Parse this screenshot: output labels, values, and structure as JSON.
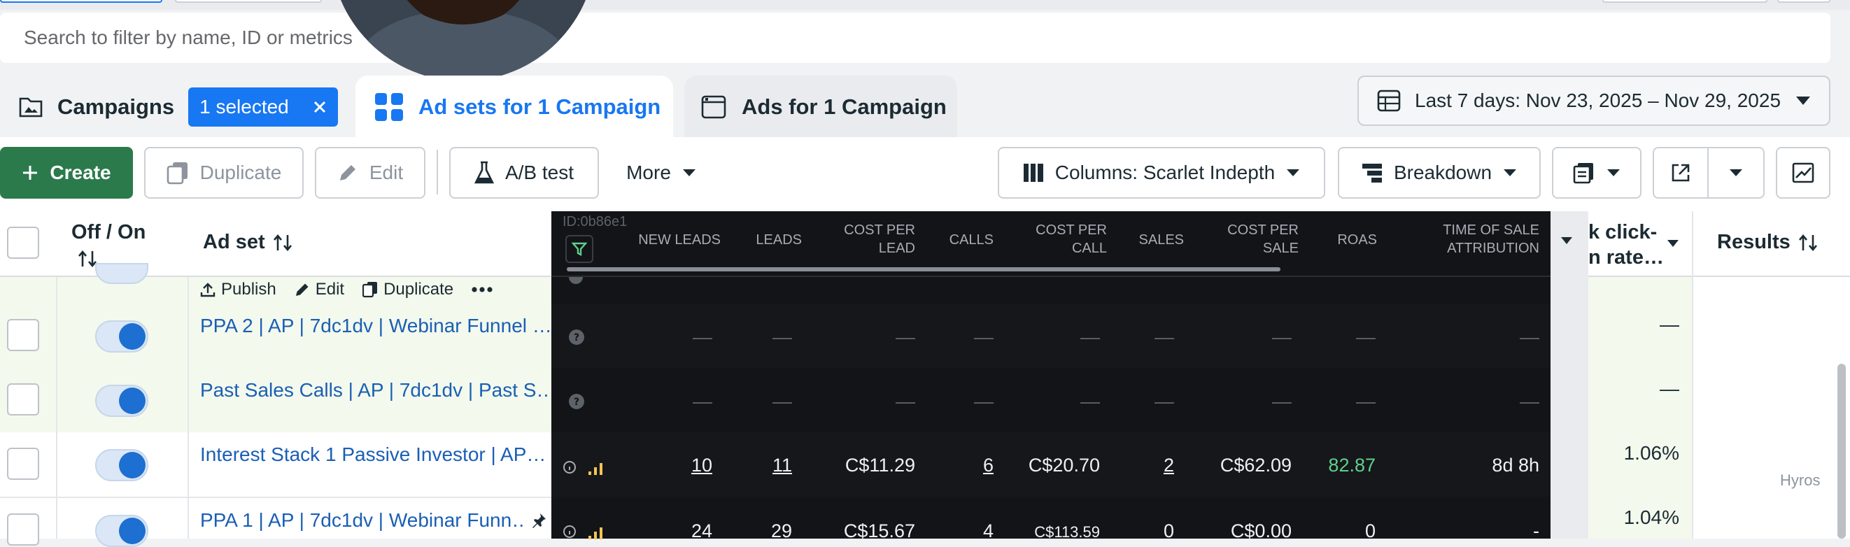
{
  "search": {
    "placeholder": "Search to filter by name, ID or metrics"
  },
  "tabs": {
    "campaigns": "Campaigns",
    "selected_badge": "1 selected",
    "adsets": "Ad sets for 1 Campaign",
    "ads": "Ads for 1 Campaign"
  },
  "date_range": "Last 7 days: Nov 23, 2025 – Nov 29, 2025",
  "toolbar": {
    "create": "Create",
    "duplicate": "Duplicate",
    "edit": "Edit",
    "ab_test": "A/B test",
    "more": "More",
    "columns": "Columns: Scarlet Indepth",
    "breakdown": "Breakdown"
  },
  "table": {
    "headers": {
      "off_on": "Off / On",
      "ad_set": "Ad set",
      "link_click": "k click-",
      "link_rate": "n rate…",
      "results": "Results"
    },
    "row_actions": {
      "publish": "Publish",
      "edit": "Edit",
      "duplicate": "Duplicate"
    },
    "rows": [
      {
        "name": "PPA 2 | AP | 7dc1dv | Webinar Funnel …",
        "ctr": "—"
      },
      {
        "name": "Past Sales Calls | AP | 7dc1dv | Past S…",
        "ctr": "—"
      },
      {
        "name": "Interest Stack 1 Passive Investor | AP…",
        "ctr": "1.06%"
      },
      {
        "name": "PPA 1 | AP | 7dc1dv | Webinar Funn…",
        "ctr": "1.04%"
      }
    ]
  },
  "hyros": {
    "id": "ID:0b86e1",
    "headers": [
      "NEW LEADS",
      "LEADS",
      "COST PER LEAD",
      "CALLS",
      "COST PER CALL",
      "SALES",
      "COST PER SALE",
      "ROAS",
      "TIME OF SALE ATTRIBUTION"
    ],
    "header_lines": [
      [
        "NEW LEADS"
      ],
      [
        "LEADS"
      ],
      [
        "COST PER",
        "LEAD"
      ],
      [
        "CALLS"
      ],
      [
        "COST PER",
        "CALL"
      ],
      [
        "SALES"
      ],
      [
        "COST PER",
        "SALE"
      ],
      [
        "ROAS"
      ],
      [
        "TIME OF SALE",
        "ATTRIBUTION"
      ]
    ],
    "rows": [
      {
        "new_leads": "—",
        "leads": "—",
        "cpl": "—",
        "calls": "—",
        "cpc": "—",
        "sales": "—",
        "cps": "—",
        "roas": "—",
        "tosa": "—"
      },
      {
        "new_leads": "—",
        "leads": "—",
        "cpl": "—",
        "calls": "—",
        "cpc": "—",
        "sales": "—",
        "cps": "—",
        "roas": "—",
        "tosa": "—"
      },
      {
        "new_leads": "10",
        "leads": "11",
        "cpl": "C$11.29",
        "calls": "6",
        "cpc": "C$20.70",
        "sales": "2",
        "cps": "C$62.09",
        "roas": "82.87",
        "tosa": "8d 8h"
      },
      {
        "new_leads": "24",
        "leads": "29",
        "cpl": "C$15.67",
        "calls": "4",
        "cpc": "C$113.59",
        "sales": "0",
        "cps": "C$0.00",
        "roas": "0",
        "tosa": "-"
      }
    ],
    "watermark": "Hyros"
  },
  "colors": {
    "accent": "#1877f2",
    "create": "#2b7a4b",
    "roas": "#5fd08a",
    "dark_bg": "#121418"
  }
}
